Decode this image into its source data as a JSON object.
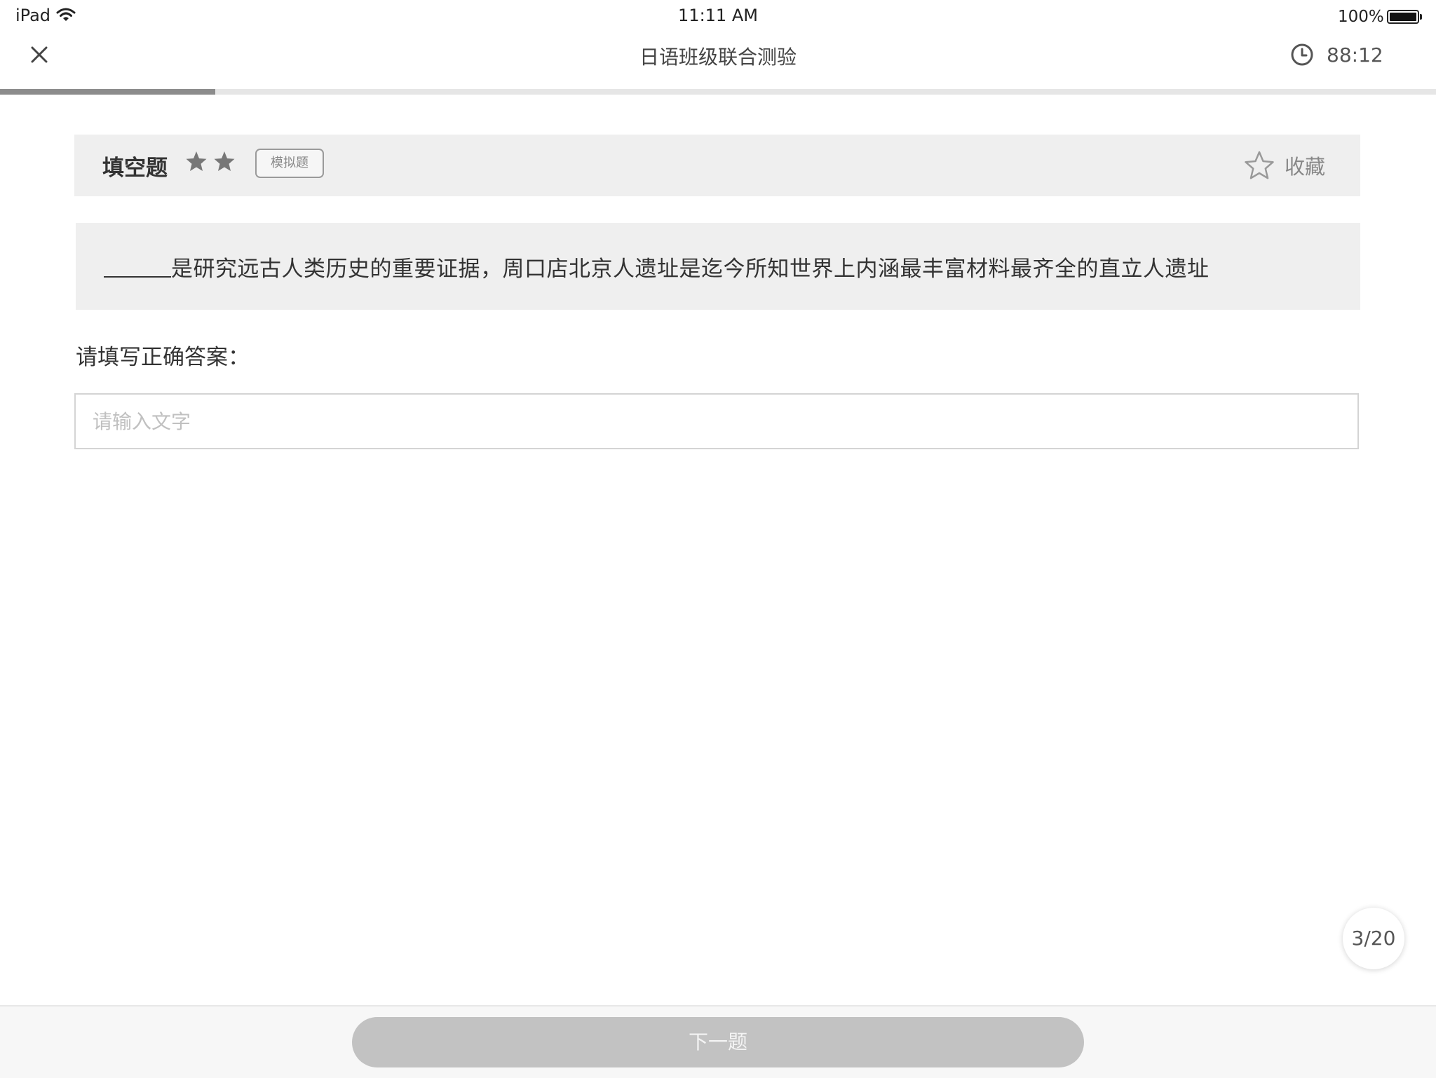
{
  "status_bar": {
    "device": "iPad",
    "time": "11:11 AM",
    "battery_text": "100%"
  },
  "nav": {
    "title": "日语班级联合测验",
    "timer": "88:12"
  },
  "progress": {
    "fraction": 0.15
  },
  "question": {
    "type_label": "填空题",
    "difficulty_stars": 2,
    "tag": "模拟题",
    "favorite_label": "收藏",
    "stem": "是研究远古人类历史的重要证据，周口店北京人遗址是迄今所知世界上内涵最丰富材料最齐全的直立人遗址"
  },
  "answer": {
    "prompt": "请填写正确答案：",
    "placeholder": "请输入文字",
    "value": ""
  },
  "pager": {
    "counter": "3/20"
  },
  "footer": {
    "next_label": "下一题"
  },
  "colors": {
    "progress_fill": "#8c8c8c",
    "header_bg": "#efefef",
    "button_disabled": "#c2c2c2"
  },
  "icons": {
    "close": "close-icon",
    "clock": "clock-icon",
    "star": "star-icon",
    "favorite": "star-outline-icon"
  }
}
